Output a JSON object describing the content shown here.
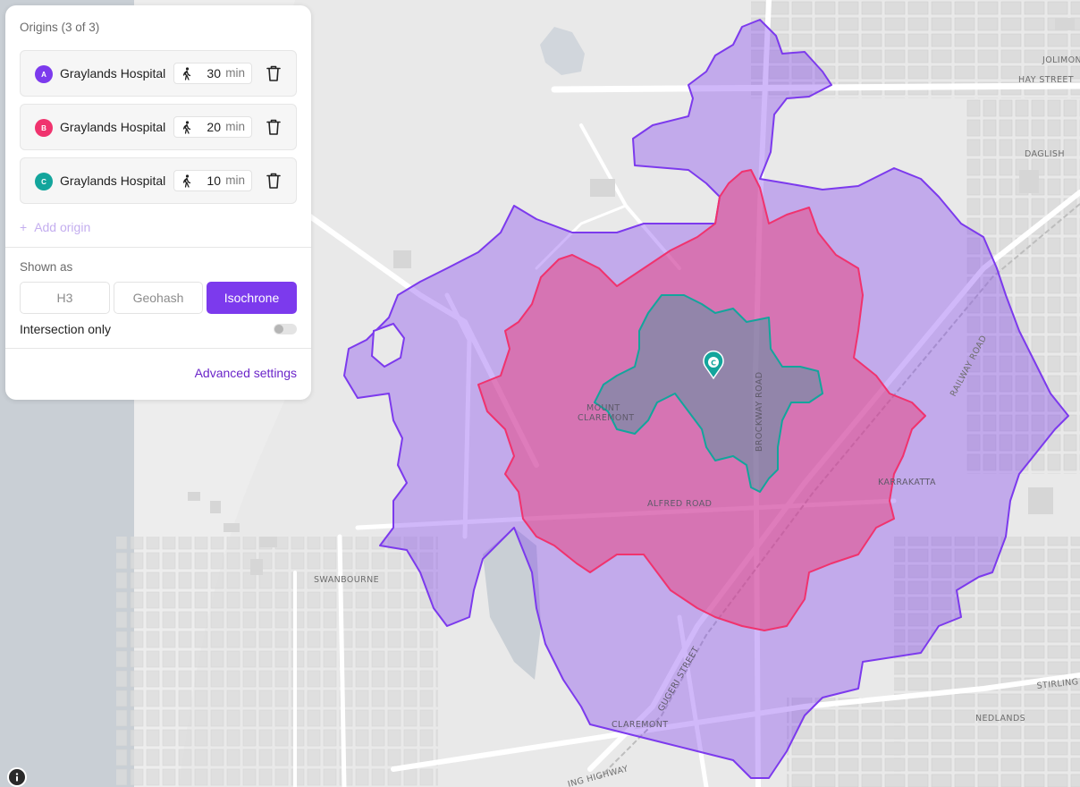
{
  "panel": {
    "origins_title": "Origins (3 of 3)",
    "origins": [
      {
        "letter": "A",
        "name": "Graylands Hospital",
        "mode_icon": "walk-icon",
        "minutes": "30",
        "unit": "min",
        "color": "#7c3aed"
      },
      {
        "letter": "B",
        "name": "Graylands Hospital",
        "mode_icon": "walk-icon",
        "minutes": "20",
        "unit": "min",
        "color": "#f0336e"
      },
      {
        "letter": "C",
        "name": "Graylands Hospital",
        "mode_icon": "walk-icon",
        "minutes": "10",
        "unit": "min",
        "color": "#13a59c"
      }
    ],
    "add_origin_label": "Add origin",
    "shown_as_title": "Shown as",
    "shown_as_options": [
      "H3",
      "Geohash",
      "Isochrone"
    ],
    "shown_as_selected": "Isochrone",
    "intersection_label": "Intersection only",
    "intersection_on": false,
    "advanced_label": "Advanced settings"
  },
  "map": {
    "labels": {
      "jolimont": "JOLIMON",
      "hay_street": "HAY STREET",
      "daglish": "DAGLISH",
      "railway_road": "RAILWAY ROAD",
      "mount": "MOUNT",
      "claremont_mt": "CLAREMONT",
      "brockway_road": "BROCKWAY ROAD",
      "karrakatta": "KARRAKATTA",
      "alfred_road": "ALFRED ROAD",
      "swanbourne": "SWANBOURNE",
      "gugeri_street": "GUGERI STREET",
      "claremont": "CLAREMONT",
      "nedlands": "NEDLANDS",
      "stirling": "STIRLING H",
      "highway": "ING HIGHWAY"
    },
    "marker_letter": "C",
    "colors": {
      "isochrone_30": "#7c3aed",
      "isochrone_20": "#f0336e",
      "isochrone_10": "#13a59c",
      "water": "#c9cfd5",
      "land": "#e9e9e9"
    }
  }
}
